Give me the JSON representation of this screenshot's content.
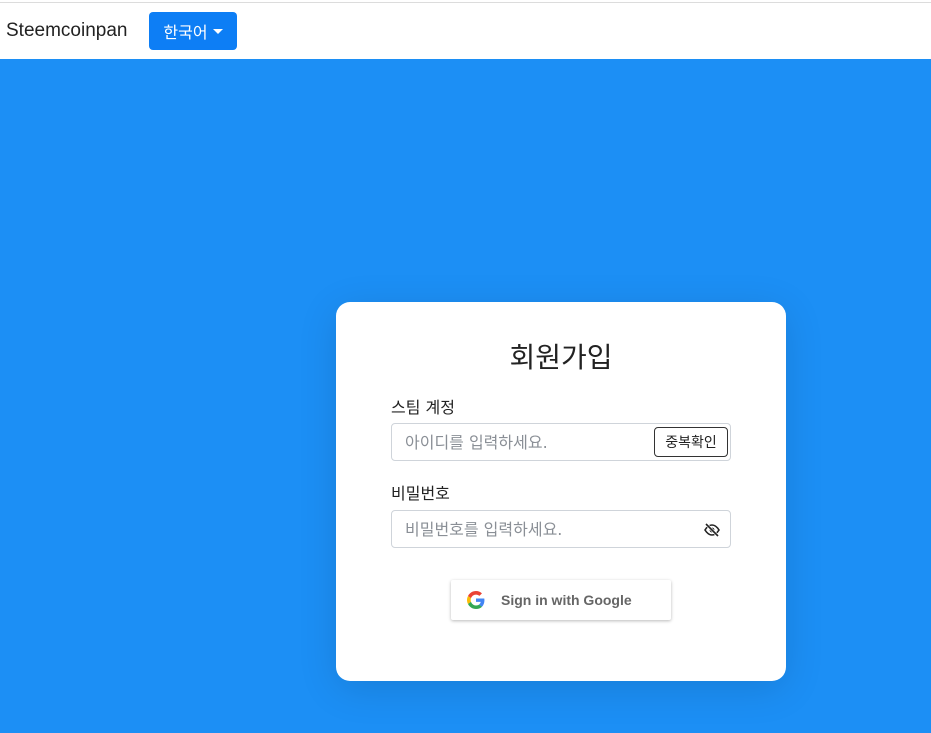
{
  "navbar": {
    "brand": "Steemcoinpan",
    "language_button": "한국어"
  },
  "signup": {
    "title": "회원가입",
    "account_label": "스팀 계정",
    "account_placeholder": "아이디를 입력하세요.",
    "check_button": "중복확인",
    "password_label": "비밀번호",
    "password_placeholder": "비밀번호를 입력하세요.",
    "google_button": "Sign in with Google"
  },
  "icons": {
    "password_toggle": "eye-slash-icon",
    "google": "google-g-icon",
    "language_dropdown": "caret-down-icon"
  },
  "colors": {
    "background": "#1c8ff5",
    "primary_button": "#0d7ef5",
    "card": "#ffffff"
  }
}
